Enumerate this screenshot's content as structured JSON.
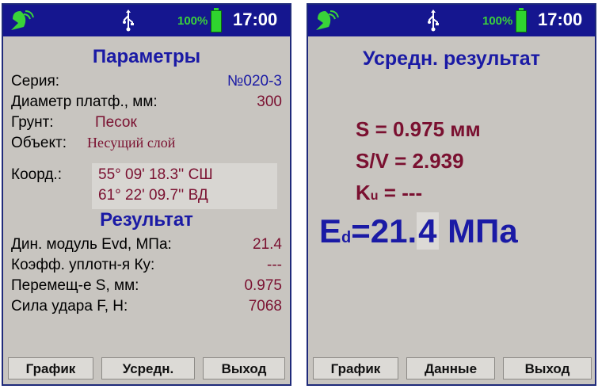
{
  "status": {
    "battery": "100%",
    "time": "17:00"
  },
  "left": {
    "title": "Параметры",
    "series_label": "Серия:",
    "series_value": "№020-3",
    "diameter_label": "Диаметр платф., мм:",
    "diameter_value": "300",
    "soil_label": "Грунт:",
    "soil_value": "Песок",
    "object_label": "Объект:",
    "object_value": "Несущий слой",
    "coord_label": "Коорд.:",
    "coord_lat": "55° 09' 18.3'' СШ",
    "coord_lon": "61° 22' 09.7'' ВД",
    "result_title": "Результат",
    "evd_label": "Дин. модуль Evd, МПа:",
    "evd_value": "21.4",
    "ky_label": "Коэфф. уплотн-я Ку:",
    "ky_value": "---",
    "s_label": "Перемещ-е S, мм:",
    "s_value": "0.975",
    "f_label": "Сила удара F, Н:",
    "f_value": "7068",
    "buttons": [
      "График",
      "Усредн.",
      "Выход"
    ]
  },
  "right": {
    "title": "Усредн. результат",
    "s_line": "S = 0.975 мм",
    "sv_line": "S/V = 2.939",
    "ku_main": "K",
    "ku_sub": "u",
    "ku_rest": " = ---",
    "ed_main": "E",
    "ed_sub": "d",
    "ed_eq": "=21.",
    "ed_hl": "4",
    "ed_unit": " МПа",
    "buttons": [
      "График",
      "Данные",
      "Выход"
    ]
  },
  "icons": {
    "satellite": "satellite-dish-icon",
    "usb": "usb-icon",
    "battery": "battery-icon"
  }
}
